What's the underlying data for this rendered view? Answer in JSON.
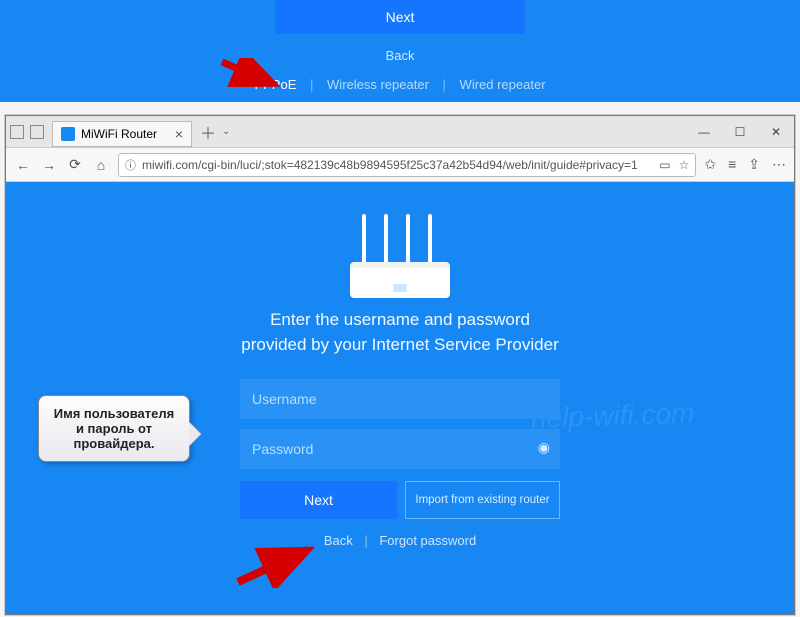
{
  "top_panel": {
    "next_label": "Next",
    "back_label": "Back",
    "tabs": {
      "pppoe": "PPPoE",
      "wireless": "Wireless repeater",
      "wired": "Wired repeater"
    }
  },
  "browser": {
    "tab_title": "MiWiFi Router",
    "url": "miwifi.com/cgi-bin/luci/;stok=482139c48b9894595f25c37a42b54d94/web/init/guide#privacy=1"
  },
  "page": {
    "heading": "Enter the username and password provided by your Internet Service Provider",
    "username_placeholder": "Username",
    "password_placeholder": "Password",
    "next_label": "Next",
    "import_label": "Import from existing router",
    "back_label": "Back",
    "forgot_label": "Forgot password"
  },
  "callout": {
    "text": "Имя пользователя и пароль от провайдера."
  },
  "watermark": "help-wifi.com"
}
